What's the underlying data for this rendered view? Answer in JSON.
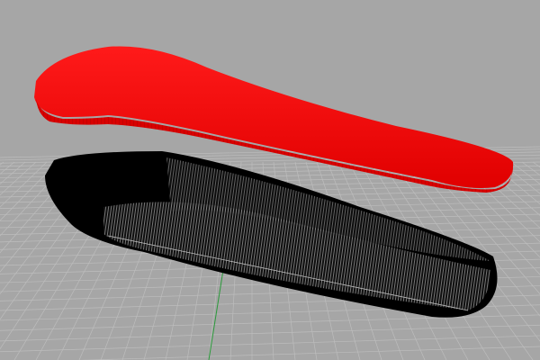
{
  "viewport": {
    "background_color": "#a6a6a6",
    "grid_color": "#bcbcbc",
    "axis_color": "#2a9a3a",
    "objects": [
      {
        "name": "seat-cushion",
        "color": "#e00000"
      },
      {
        "name": "hull-shell",
        "color": "#000000"
      }
    ]
  }
}
